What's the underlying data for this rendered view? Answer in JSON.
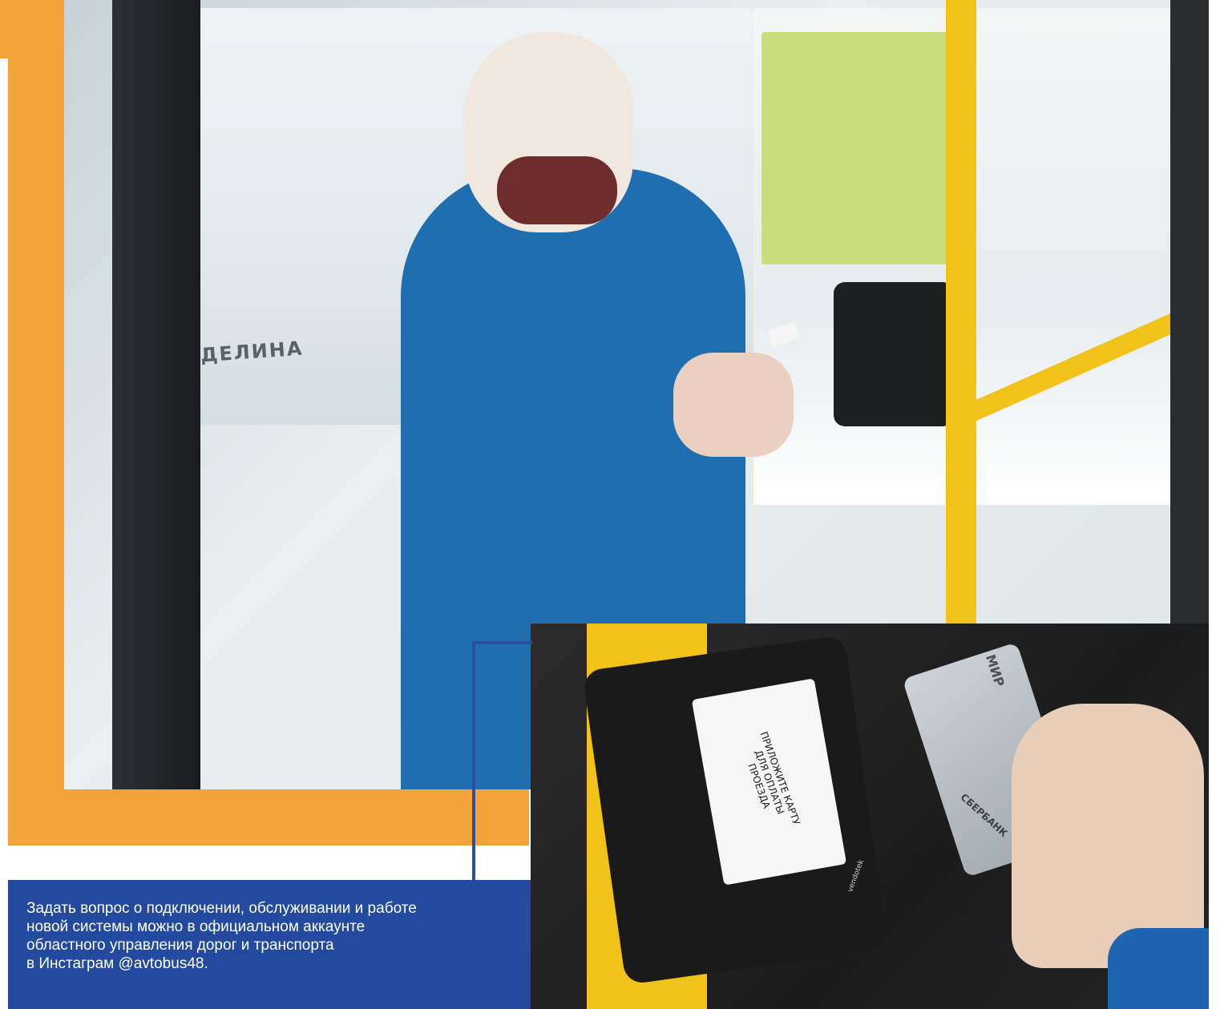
{
  "caption": {
    "text": "Задать вопрос о подключении, обслуживании и работе\nновой системы можно в официальном аккаунте\nобластного управления дорог и транспорта\nв Инстаграм @avtobus48."
  },
  "main_photo": {
    "bus_sign_text": "ДЕЛИНА"
  },
  "inset_photo": {
    "validator_screen_text": "ПРИЛОЖИТЕ КАРТУ\nДЛЯ ОПЛАТЫ\nПРОЕЗДА",
    "validator_brand": "vendotek",
    "card_brand": "МИР",
    "card_bank": "СБЕРБАНК"
  },
  "colors": {
    "orange_frame": "#f2a33a",
    "caption_blue": "#234a9f"
  }
}
